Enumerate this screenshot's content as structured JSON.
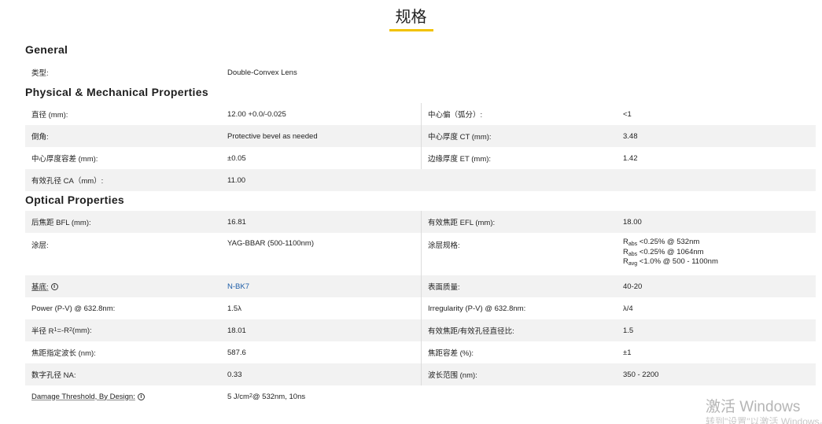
{
  "title": "规格",
  "sections": {
    "general": "General",
    "physical": "Physical & Mechanical Properties",
    "optical": "Optical Properties"
  },
  "general": [
    {
      "label": "类型:",
      "value": "Double-Convex Lens"
    }
  ],
  "physical": [
    {
      "l1": "直径 (mm):",
      "v1": "12.00 +0.0/-0.025",
      "l2": "中心偏（弧分）:",
      "v2": "<1"
    },
    {
      "l1": "倒角:",
      "v1": "Protective bevel as needed",
      "l2": "中心厚度 CT (mm):",
      "v2": "3.48"
    },
    {
      "l1": "中心厚度容差 (mm):",
      "v1": "±0.05",
      "l2": "边缘厚度 ET (mm):",
      "v2": "1.42"
    },
    {
      "l1": "有效孔径 CA（mm）:",
      "v1": "11.00"
    }
  ],
  "optical": {
    "bfl_label": "后焦距 BFL (mm):",
    "bfl_value": "16.81",
    "efl_label": "有效焦距 EFL (mm):",
    "efl_value": "18.00",
    "coating_label": "涂层:",
    "coating_value": "YAG-BBAR (500-1100nm)",
    "coating_spec_label": "涂层规格:",
    "coating_spec": [
      {
        "sym": "R",
        "sub": "abs",
        "text": " <0.25% @ 532nm"
      },
      {
        "sym": "R",
        "sub": "abs",
        "text": " <0.25% @ 1064nm"
      },
      {
        "sym": "R",
        "sub": "avg",
        "text": " <1.0% @ 500 - 1100nm"
      }
    ],
    "substrate_label": "基底:",
    "substrate_value": "N-BK7",
    "surface_label": "表面质量:",
    "surface_value": "40-20",
    "power_label": "Power (P-V) @ 632.8nm:",
    "power_value": "1.5λ",
    "irregularity_label": "Irregularity (P-V) @ 632.8nm:",
    "irregularity_value": "λ/4",
    "radius_label_pre": "半径 R",
    "radius_sub1": "1",
    "radius_label_mid": "=-R",
    "radius_sub2": "2",
    "radius_label_post": " (mm):",
    "radius_value": "18.01",
    "ratio_label": "有效焦距/有效孔径直径比:",
    "ratio_value": "1.5",
    "design_wl_label": "焦距指定波长 (nm):",
    "design_wl_value": "587.6",
    "focal_tol_label": "焦距容差 (%):",
    "focal_tol_value": "±1",
    "na_label": "数字孔径 NA:",
    "na_value": "0.33",
    "wl_range_label": "波长范围 (nm):",
    "wl_range_value": "350 - 2200",
    "damage_label": "Damage Threshold, By Design:",
    "damage_pre": "5 J/cm",
    "damage_sup": "2",
    "damage_post": " @ 532nm, 10ns"
  },
  "icons": {
    "info": "info-icon"
  },
  "watermark": {
    "line1": "激活 Windows",
    "line2": "转到\"设置\"以激活 Windows。"
  },
  "colors": {
    "accent": "#f2c200",
    "link": "#1e5ea8",
    "shade": "#f2f2f2"
  }
}
